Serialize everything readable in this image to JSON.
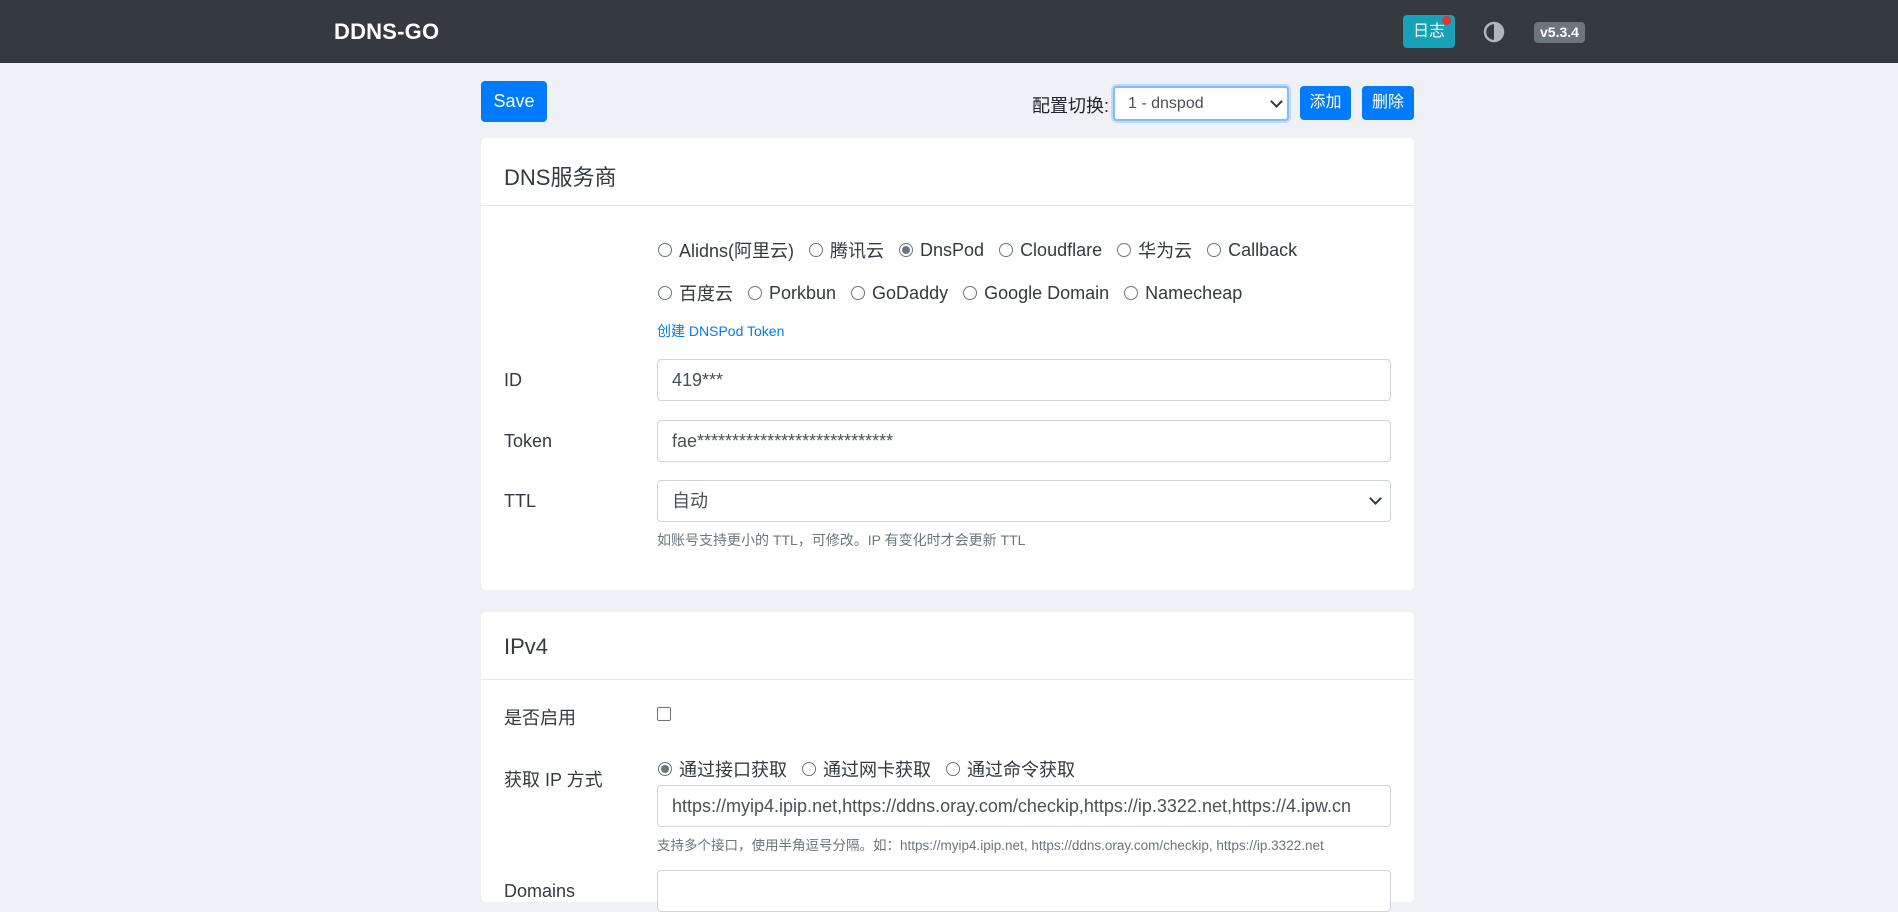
{
  "navbar": {
    "brand": "DDNS-GO",
    "log_button": "日志",
    "theme_icon": "contrast-icon",
    "version": "v5.3.4"
  },
  "toolbar": {
    "save_label": "Save",
    "config_label": "配置切换:",
    "config_selected": "1 - dnspod",
    "add_label": "添加",
    "delete_label": "删除"
  },
  "dns_card": {
    "title": "DNS服务商",
    "providers_row1": [
      {
        "label": "Alidns(阿里云)",
        "checked": false
      },
      {
        "label": "腾讯云",
        "checked": false
      },
      {
        "label": "DnsPod",
        "checked": true
      },
      {
        "label": "Cloudflare",
        "checked": false
      },
      {
        "label": "华为云",
        "checked": false
      },
      {
        "label": "Callback",
        "checked": false
      }
    ],
    "providers_row2": [
      {
        "label": "百度云",
        "checked": false
      },
      {
        "label": "Porkbun",
        "checked": false
      },
      {
        "label": "GoDaddy",
        "checked": false
      },
      {
        "label": "Google Domain",
        "checked": false
      },
      {
        "label": "Namecheap",
        "checked": false
      }
    ],
    "token_link": "创建 DNSPod Token",
    "id_label": "ID",
    "id_value": "419***",
    "token_label": "Token",
    "token_value": "fae****************************",
    "ttl_label": "TTL",
    "ttl_value": "自动",
    "ttl_hint": "如账号支持更小的 TTL，可修改。IP 有变化时才会更新 TTL"
  },
  "ipv4_card": {
    "title": "IPv4",
    "enable_label": "是否启用",
    "enabled": false,
    "ip_method_label": "获取 IP 方式",
    "ip_methods": [
      {
        "label": "通过接口获取",
        "checked": true
      },
      {
        "label": "通过网卡获取",
        "checked": false
      },
      {
        "label": "通过命令获取",
        "checked": false
      }
    ],
    "url_value": "https://myip4.ipip.net,https://ddns.oray.com/checkip,https://ip.3322.net,https://4.ipw.cn",
    "url_hint": "支持多个接口，使用半角逗号分隔。如：https://myip4.ipip.net, https://ddns.oray.com/checkip, https://ip.3322.net",
    "domains_label": "Domains"
  }
}
